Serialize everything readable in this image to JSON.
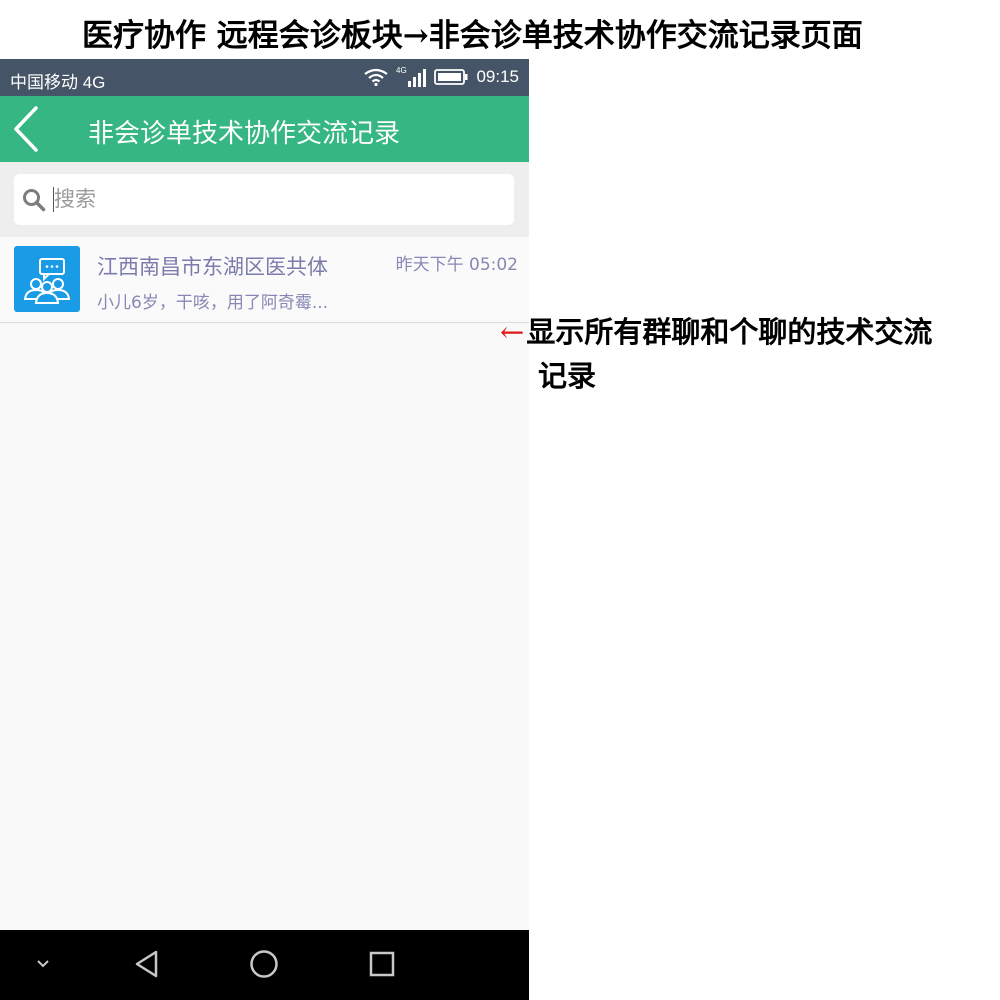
{
  "page_caption": "医疗协作 远程会诊板块→非会诊单技术协作交流记录页面",
  "status_bar": {
    "carrier": "中国移动 4G",
    "network_badge": "4G",
    "time": "09:15"
  },
  "header": {
    "title": "非会诊单技术协作交流记录"
  },
  "search": {
    "placeholder": "搜索",
    "value": ""
  },
  "chats": [
    {
      "name": "江西南昌市东湖区医共体",
      "time": "昨天下午 05:02",
      "preview": "小儿6岁，干咳，用了阿奇霉..."
    }
  ],
  "annotation": {
    "arrow": "←",
    "line1": "显示所有群聊和个聊的技术交流",
    "line2": "记录"
  },
  "colors": {
    "header_green": "#35b683",
    "status_bar": "#455466",
    "avatar_blue": "#1a9be6",
    "chat_text": "#7b7cab",
    "annotation_arrow": "#e0191b"
  }
}
